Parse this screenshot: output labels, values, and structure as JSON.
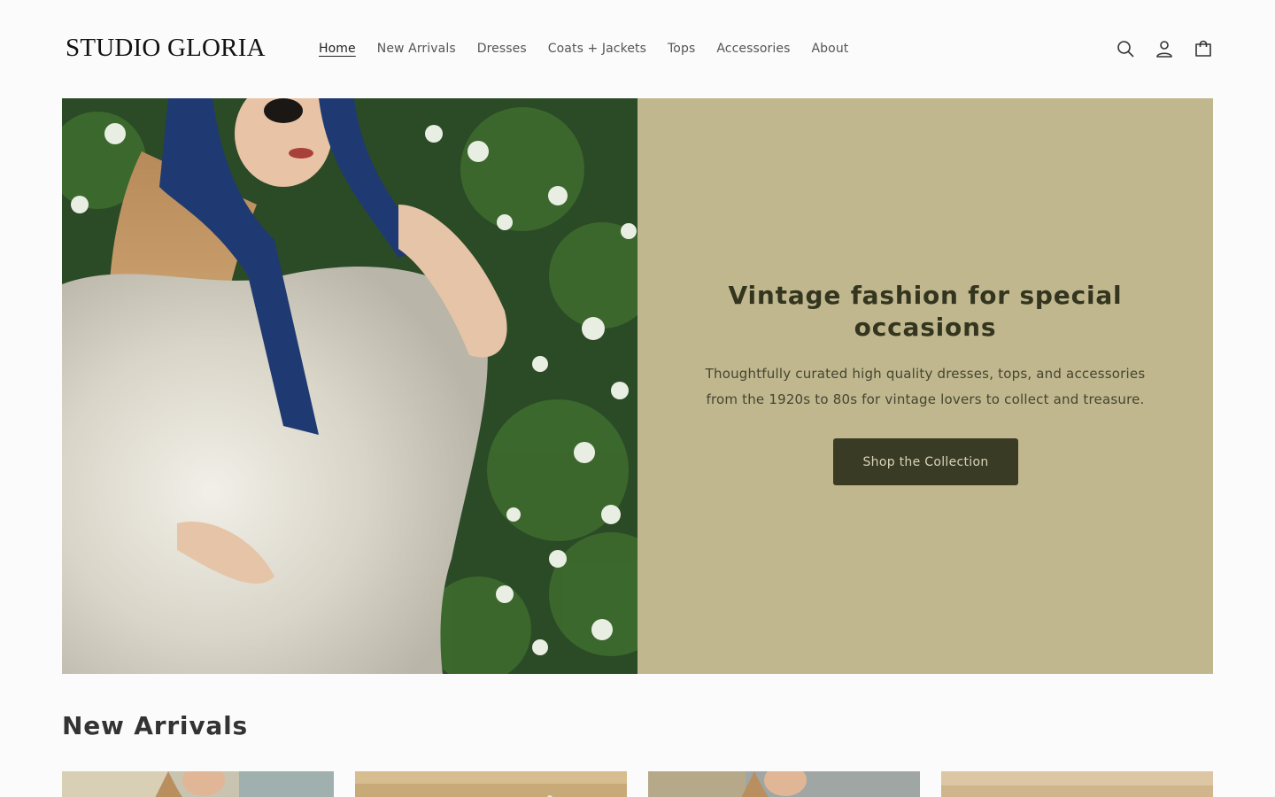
{
  "brand": {
    "name": "STUDIO GLORIA"
  },
  "nav": {
    "items": [
      {
        "label": "Home",
        "active": true
      },
      {
        "label": "New Arrivals"
      },
      {
        "label": "Dresses"
      },
      {
        "label": "Coats + Jackets"
      },
      {
        "label": "Tops"
      },
      {
        "label": "Accessories"
      },
      {
        "label": "About"
      }
    ]
  },
  "header_icons": [
    "search-icon",
    "account-icon",
    "cart-icon"
  ],
  "hero": {
    "title": "Vintage fashion for special occasions",
    "text": "Thoughtfully curated high quality dresses, tops, and accessories from the 1920s to 80s for vintage lovers to collect and treasure.",
    "button_label": "Shop the Collection",
    "panel_color": "#c0b78e",
    "button_color": "#3a3b25"
  },
  "new_arrivals": {
    "title": "New Arrivals",
    "products": [
      {
        "image": "product-photo-1"
      },
      {
        "image": "product-photo-2"
      },
      {
        "image": "product-photo-3"
      },
      {
        "image": "product-photo-4"
      }
    ]
  }
}
